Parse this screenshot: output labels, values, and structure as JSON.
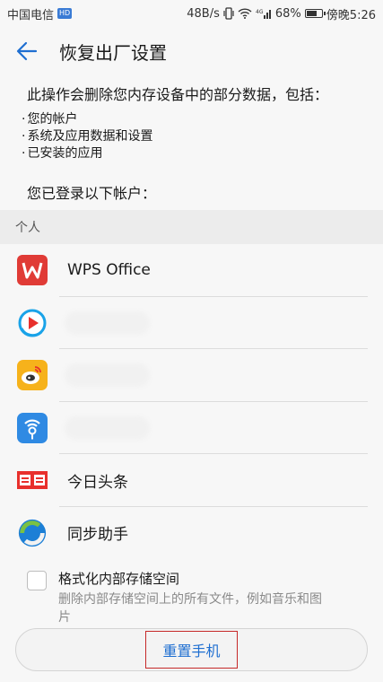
{
  "status_bar": {
    "carrier": "中国电信",
    "hd_badge": "HD",
    "net_speed": "48B/s",
    "signal_label": "4G",
    "battery_pct": "68%",
    "battery_level": 0.68,
    "time": "傍晚5:26"
  },
  "header": {
    "title": "恢复出厂设置",
    "back_icon": "arrow-left-icon"
  },
  "description": {
    "intro": "此操作会删除您内存设备中的部分数据，包括：",
    "items": [
      "您的帐户",
      "系统及应用数据和设置",
      "已安装的应用"
    ],
    "accounts_intro": "您已登录以下帐户："
  },
  "section": {
    "personal_label": "个人"
  },
  "accounts": [
    {
      "name": "WPS Office",
      "icon": "wps-icon"
    },
    {
      "name": "",
      "icon": "video-play-icon"
    },
    {
      "name": "",
      "icon": "weibo-icon"
    },
    {
      "name": "",
      "icon": "wifi-key-icon"
    },
    {
      "name": "今日头条",
      "icon": "toutiao-icon"
    },
    {
      "name": "同步助手",
      "icon": "sync-assistant-icon"
    }
  ],
  "format_option": {
    "title": "格式化内部存储空间",
    "description": "删除内部存储空间上的所有文件，例如音乐和图片",
    "checked": false
  },
  "reset_button": {
    "label": "重置手机"
  },
  "colors": {
    "accent": "#1f6fd1",
    "wps_red": "#e03b36",
    "toutiao_red": "#e8302c",
    "highlight_border": "#c62828"
  }
}
